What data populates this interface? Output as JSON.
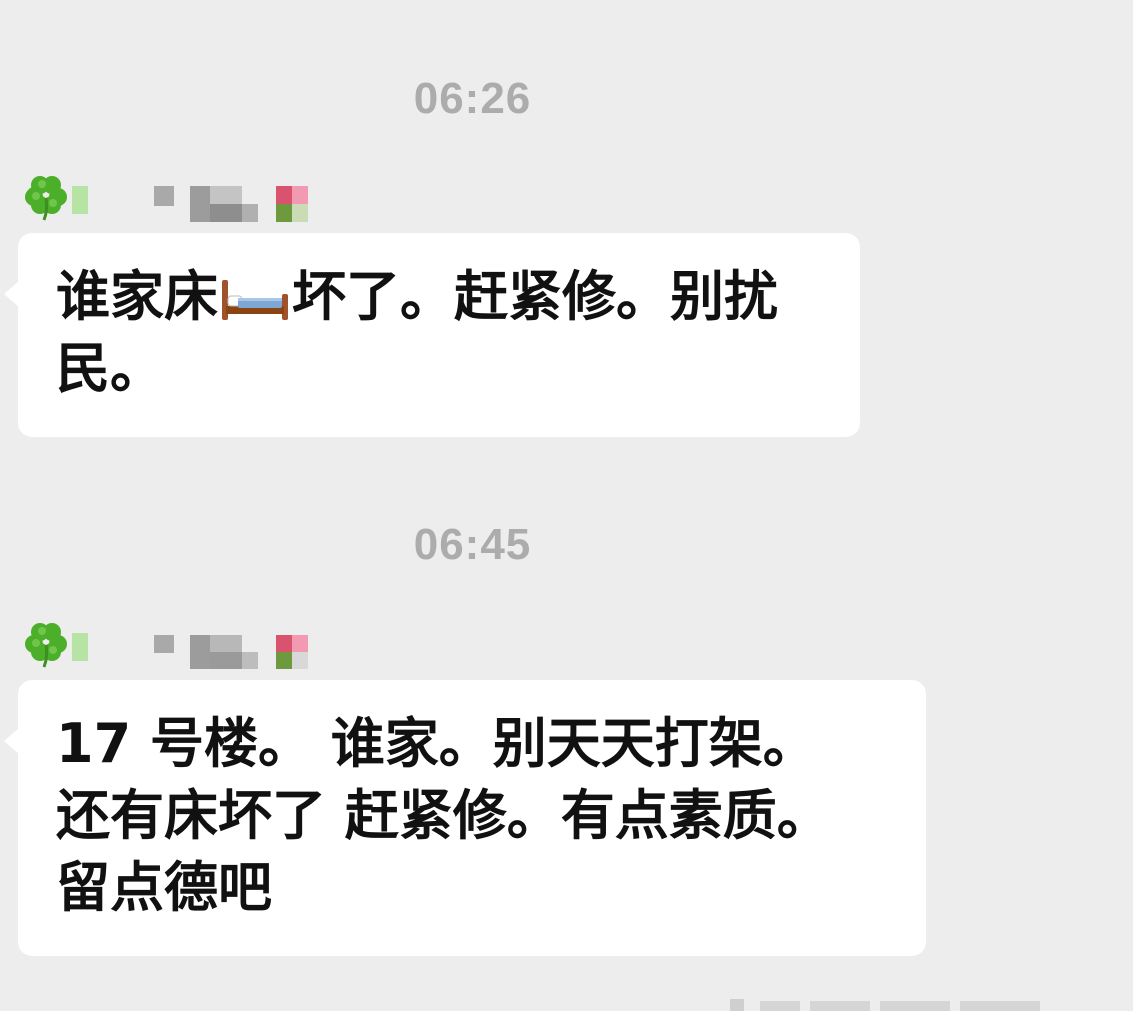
{
  "chat": {
    "messages": [
      {
        "time": "06:26",
        "sender_avatar_icon": "four-leaf-clover-icon",
        "text_before_icon": "谁家床",
        "inline_icon": "bed-emoji-icon",
        "text_after_icon": "坏了。赶紧修。别扰\n民。"
      },
      {
        "time": "06:45",
        "sender_avatar_icon": "four-leaf-clover-icon",
        "text": "17 号楼。 谁家。别天天打架。\n还有床坏了 赶紧修。有点素质。\n留点德吧"
      }
    ]
  },
  "colors": {
    "background": "#ededed",
    "bubble": "#ffffff",
    "timestamp": "#acacac",
    "text": "#111111",
    "clover": "#4caf2a"
  }
}
